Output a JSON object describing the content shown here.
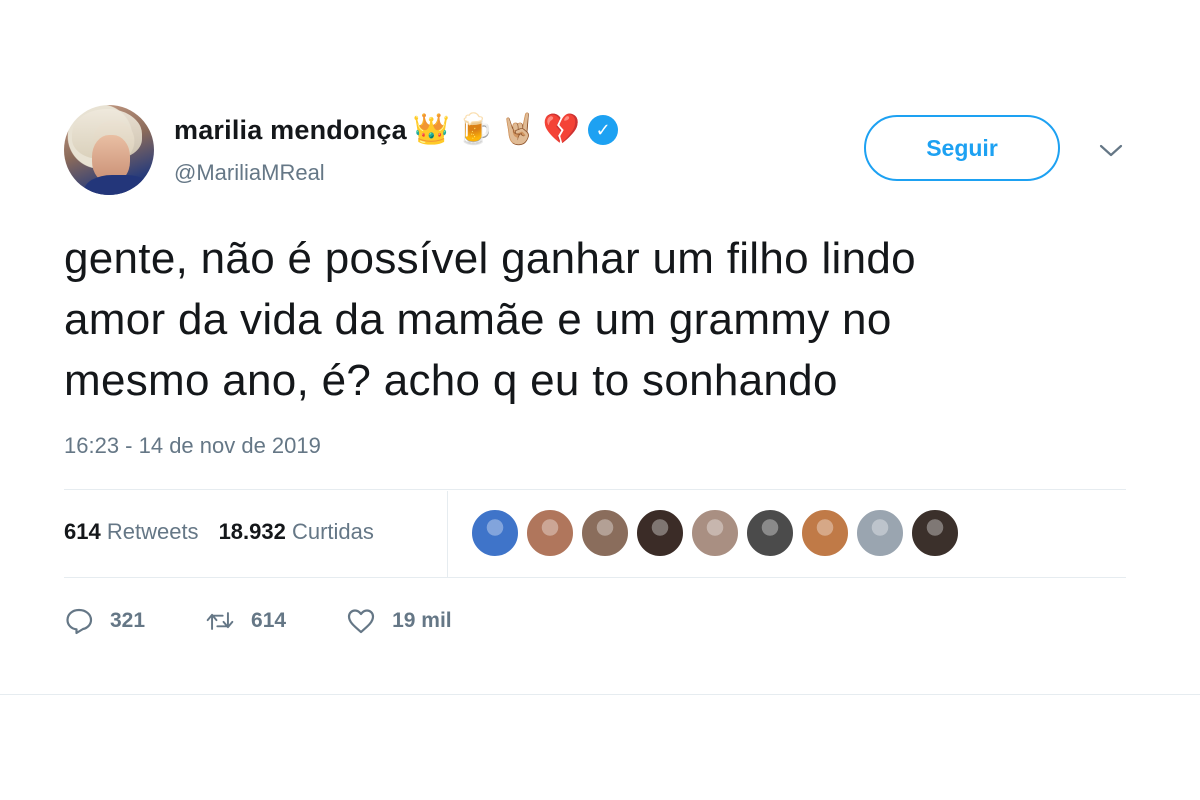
{
  "user": {
    "display_name": "marilia mendonça",
    "name_emojis": [
      "👑",
      "🍺",
      "🤘🏼",
      "💔"
    ],
    "verified_icon": "verified-badge-icon",
    "handle": "@MariliaMReal"
  },
  "follow_button": {
    "label": "Seguir"
  },
  "menu_icon": "chevron-down-icon",
  "tweet": {
    "text_lines": [
      "gente, não é possível ganhar um filho lindo",
      "amor da vida da mamãe e um grammy no",
      "mesmo ano, é? acho q eu to sonhando"
    ],
    "timestamp": "16:23 - 14 de nov de 2019"
  },
  "stats": {
    "retweets_count": "614",
    "retweets_label": "Retweets",
    "likes_count": "18.932",
    "likes_label": "Curtidas"
  },
  "likers_avatar_colors": [
    "#3f74c9",
    "#b0765c",
    "#8a6d5c",
    "#3b2c27",
    "#a98f82",
    "#4b4b4b",
    "#c07a47",
    "#9aa5b0",
    "#3b302b"
  ],
  "actions": {
    "reply": {
      "icon": "reply-icon",
      "count": "321"
    },
    "retweet": {
      "icon": "retweet-icon",
      "count": "614"
    },
    "like": {
      "icon": "heart-icon",
      "count": "19 mil"
    }
  },
  "colors": {
    "accent": "#1da1f2",
    "text": "#14171a",
    "secondary": "#657786",
    "divider": "#e6ecf0"
  }
}
